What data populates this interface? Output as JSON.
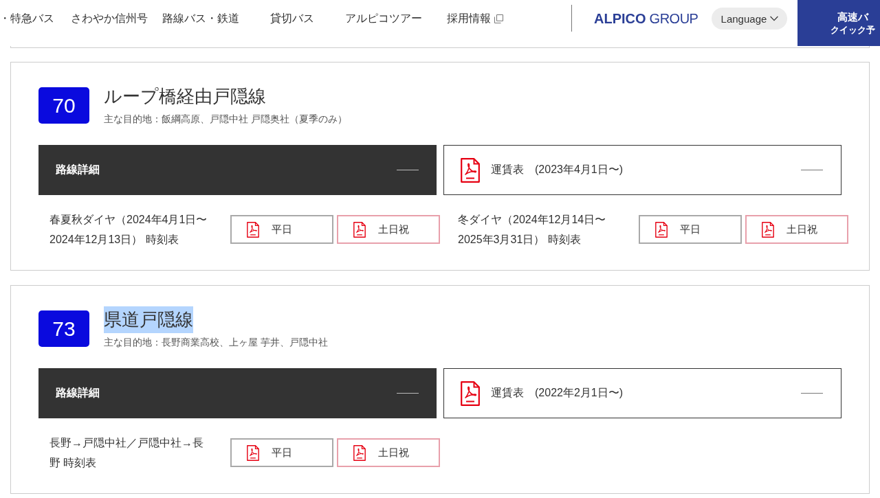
{
  "header": {
    "nav": [
      {
        "label": "・特急バス",
        "external": false
      },
      {
        "label": "さわやか信州号",
        "external": false
      },
      {
        "label": "路線バス・鉄道",
        "external": false
      },
      {
        "label": "貸切バス",
        "external": false
      },
      {
        "label": "アルピコツアー",
        "external": false
      },
      {
        "label": "採用情報",
        "external": true
      }
    ],
    "logo": "**ALPICO** GROUP",
    "language_button": "Language",
    "quick_booking": [
      "高速バ",
      "クイック予"
    ]
  },
  "routes": [
    {
      "number": "70",
      "color": "#0a0ade",
      "title": "ループ橋経由戸隠線",
      "title_selected": false,
      "destinations": "主な目的地：飯綱高原、戸隠中社 戸隠奥社（夏季のみ）",
      "details": {
        "label": "路線詳細",
        "expanded": true
      },
      "fare": {
        "label": "運賃表　(2023年4月1日〜)"
      },
      "timetables": [
        {
          "label": "春夏秋ダイヤ（2024年4月1日〜2024年12月13日） 時刻表",
          "buttons": [
            {
              "label": "平日",
              "kind": "weekday"
            },
            {
              "label": "土日祝",
              "kind": "holiday"
            }
          ]
        },
        {
          "label": "冬ダイヤ（2024年12月14日〜2025年3月31日） 時刻表",
          "buttons": [
            {
              "label": "平日",
              "kind": "weekday"
            },
            {
              "label": "土日祝",
              "kind": "holiday"
            }
          ]
        }
      ]
    },
    {
      "number": "73",
      "color": "#0a0ade",
      "title": "県道戸隠線",
      "title_selected": true,
      "destinations": "主な目的地：長野商業高校、上ヶ屋 芋井、戸隠中社",
      "details": {
        "label": "路線詳細",
        "expanded": true
      },
      "fare": {
        "label": "運賃表　(2022年2月1日〜)"
      },
      "timetables": [
        {
          "label": "長野→戸隠中社／戸隠中社→長野 時刻表",
          "buttons": [
            {
              "label": "平日",
              "kind": "weekday"
            },
            {
              "label": "土日祝",
              "kind": "holiday"
            }
          ]
        }
      ]
    }
  ]
}
